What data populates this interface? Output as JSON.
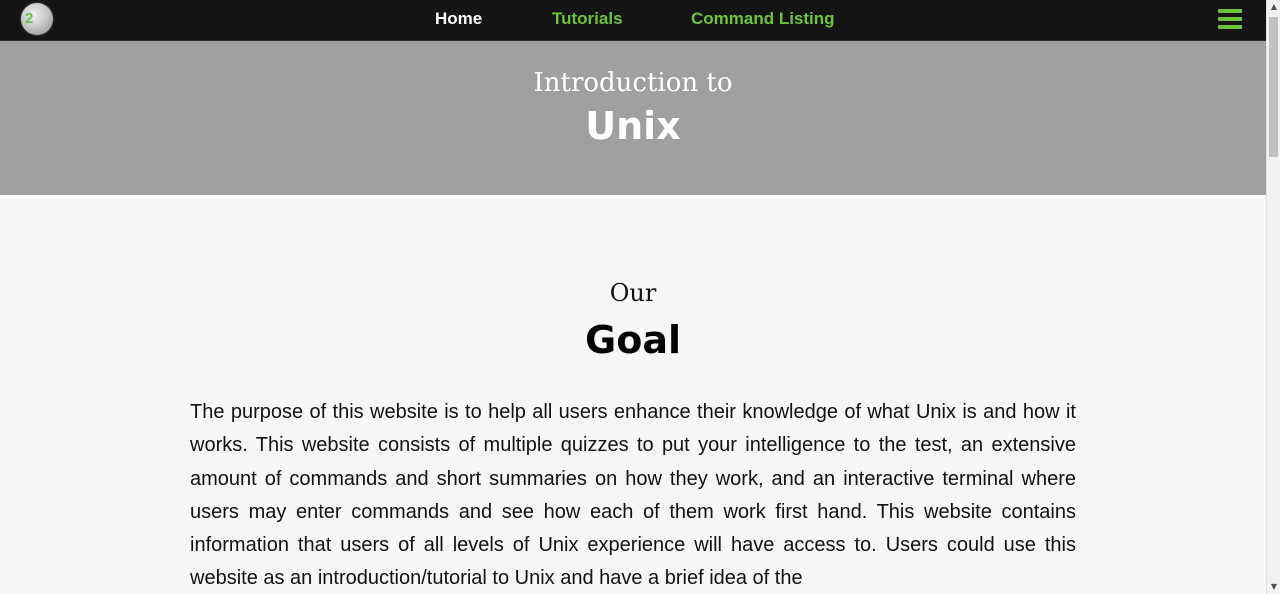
{
  "nav": {
    "logo_text": "2",
    "links": [
      {
        "label": "Home",
        "active": true
      },
      {
        "label": "Tutorials",
        "active": false
      },
      {
        "label": "Command Listing",
        "active": false
      }
    ],
    "menu_icon": "hamburger-menu-icon",
    "accent_color": "#6cc43c"
  },
  "hero": {
    "intro": "Introduction to",
    "title": "Unix"
  },
  "goal": {
    "our": "Our",
    "title": "Goal",
    "text": "The purpose of this website is to help all users enhance their knowledge of what Unix is and how it works. This website consists of multiple quizzes to put your intelligence to the test, an extensive amount of commands and short summaries on how they work, and an interactive terminal where users may enter commands and see how each of them work first hand. This website contains information that users of all levels of Unix experience will have access to. Users could use this website as an introduction/tutorial to Unix and have a brief idea of the"
  },
  "scrollbar": {
    "up_icon": "▲",
    "down_icon": "▼"
  }
}
